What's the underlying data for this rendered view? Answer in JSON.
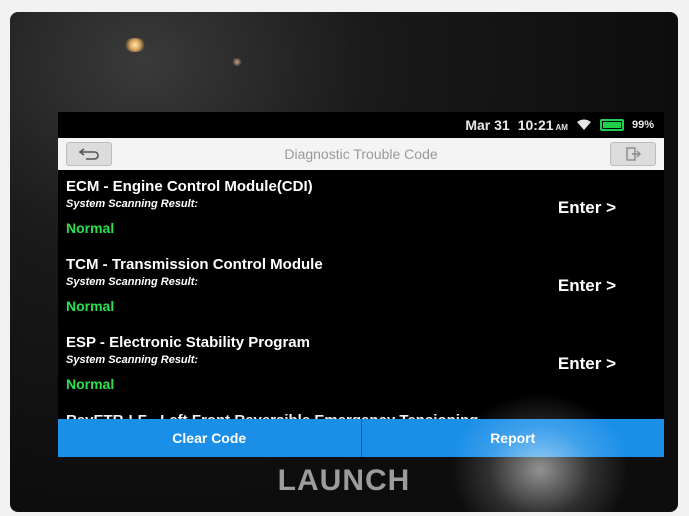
{
  "status_bar": {
    "date": "Mar 31",
    "time": "10:21",
    "ampm": "AM",
    "battery": "99%",
    "battery_level": 0.99,
    "battery_color": "#1fd14a"
  },
  "header": {
    "title": "Diagnostic Trouble Code",
    "back_icon": "back-arrow-icon",
    "exit_icon": "exit-icon"
  },
  "systems": [
    {
      "name": "ECM - Engine Control Module(CDI)",
      "sub_label": "System Scanning Result:",
      "status": "Normal",
      "action": "Enter >"
    },
    {
      "name": "TCM - Transmission Control Module",
      "sub_label": "System Scanning Result:",
      "status": "Normal",
      "action": "Enter >"
    },
    {
      "name": "ESP - Electronic Stability Program",
      "sub_label": "System Scanning Result:",
      "status": "Normal",
      "action": "Enter >"
    },
    {
      "name": "RevETR-LF - Left Front Reversible Emergency Tensioning"
    }
  ],
  "footer": {
    "clear_label": "Clear Code",
    "report_label": "Report",
    "accent": "#1b8fe8"
  },
  "device": {
    "brand": "LAUNCH"
  }
}
